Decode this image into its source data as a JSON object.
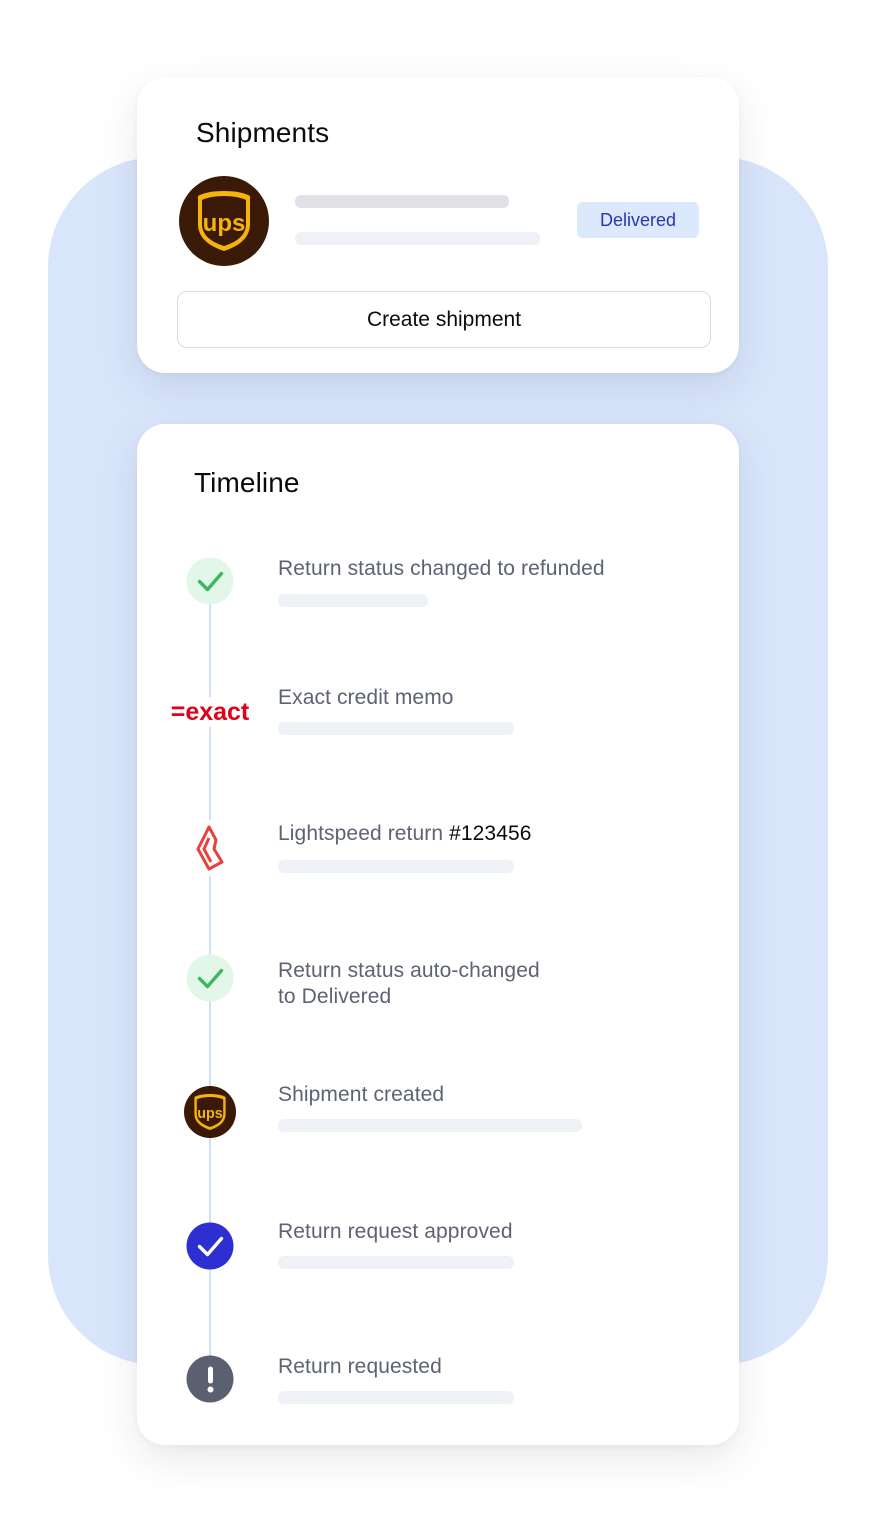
{
  "shipments": {
    "title": "Shipments",
    "carrier_icon": "ups-logo-icon",
    "carrier_logo_text": "ups",
    "status_badge": "Delivered",
    "create_button": "Create shipment"
  },
  "timeline": {
    "title": "Timeline",
    "events": [
      {
        "icon": "check-icon",
        "text": "Return status changed to refunded"
      },
      {
        "icon": "exact-logo-icon",
        "logo_text": "=exact",
        "text": "Exact credit memo"
      },
      {
        "icon": "lightspeed-logo-icon",
        "text": "Lightspeed return ",
        "highlight": "#123456"
      },
      {
        "icon": "check-icon",
        "text_line1": "Return status auto-changed",
        "text_line2": "to Delivered"
      },
      {
        "icon": "ups-logo-icon",
        "logo_text": "ups",
        "text": "Shipment created"
      },
      {
        "icon": "check-circle-filled-icon",
        "text": "Return request approved"
      },
      {
        "icon": "exclamation-icon",
        "text": "Return requested"
      }
    ]
  },
  "colors": {
    "backdrop": "#d9e5fb",
    "badge_bg": "#dce8fb",
    "badge_text": "#2b35b5",
    "check_green": "#3fb65c",
    "approved_blue": "#2d2fd1",
    "exact_red": "#e1001a",
    "lightspeed_red": "#e8413d",
    "ups_brown": "#3a1a06",
    "ups_gold": "#f5b30b"
  }
}
